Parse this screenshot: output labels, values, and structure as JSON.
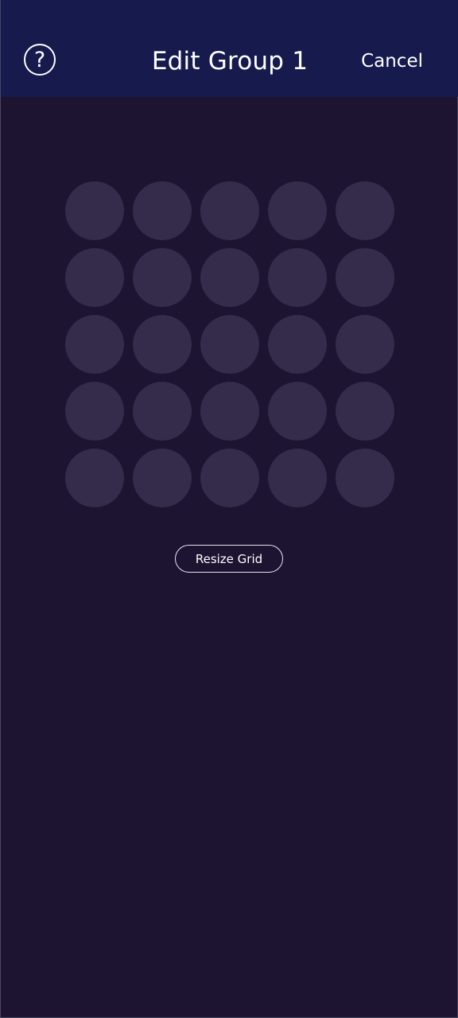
{
  "header": {
    "help_icon": "question-circle-icon",
    "help_glyph": "?",
    "title": "Edit Group 1",
    "cancel_label": "Cancel"
  },
  "grid": {
    "rows": 5,
    "columns": 5
  },
  "actions": {
    "resize_label": "Resize Grid"
  },
  "colors": {
    "header_bg": "#161a4d",
    "page_bg": "#1c1431",
    "cell": "#352b4a",
    "text": "#ffffff"
  }
}
